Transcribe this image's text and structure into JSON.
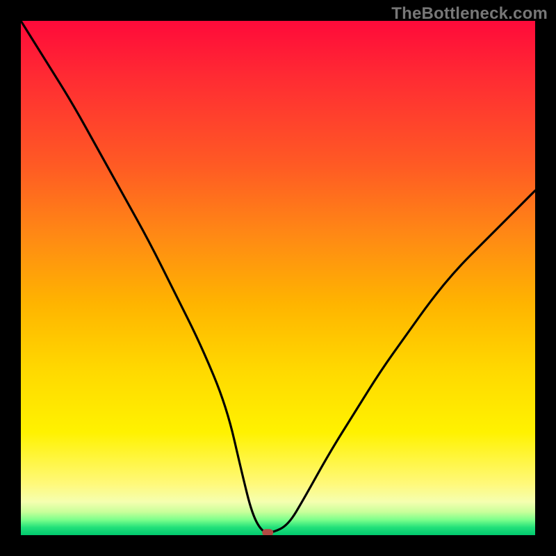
{
  "watermark": "TheBottleneck.com",
  "chart_data": {
    "type": "line",
    "title": "",
    "xlabel": "",
    "ylabel": "",
    "xlim": [
      0,
      100
    ],
    "ylim": [
      0,
      100
    ],
    "x": [
      0,
      5,
      10,
      15,
      20,
      25,
      30,
      35,
      40,
      43,
      45,
      47,
      49,
      52,
      55,
      60,
      65,
      70,
      75,
      80,
      85,
      90,
      95,
      100
    ],
    "values": [
      100,
      92,
      84,
      75,
      66,
      57,
      47,
      37,
      25,
      12,
      4,
      0.5,
      0.5,
      2,
      7,
      16,
      24,
      32,
      39,
      46,
      52,
      57,
      62,
      67
    ],
    "series": [
      {
        "name": "bottleneck-curve",
        "x": [
          0,
          5,
          10,
          15,
          20,
          25,
          30,
          35,
          40,
          43,
          45,
          47,
          49,
          52,
          55,
          60,
          65,
          70,
          75,
          80,
          85,
          90,
          95,
          100
        ],
        "values": [
          100,
          92,
          84,
          75,
          66,
          57,
          47,
          37,
          25,
          12,
          4,
          0.5,
          0.5,
          2,
          7,
          16,
          24,
          32,
          39,
          46,
          52,
          57,
          62,
          67
        ]
      }
    ],
    "highlight_point": {
      "x": 48,
      "y": 0.5
    },
    "background_gradient": {
      "top": "#ff0a3a",
      "mid": "#ffe600",
      "bottom": "#00c96e"
    }
  }
}
